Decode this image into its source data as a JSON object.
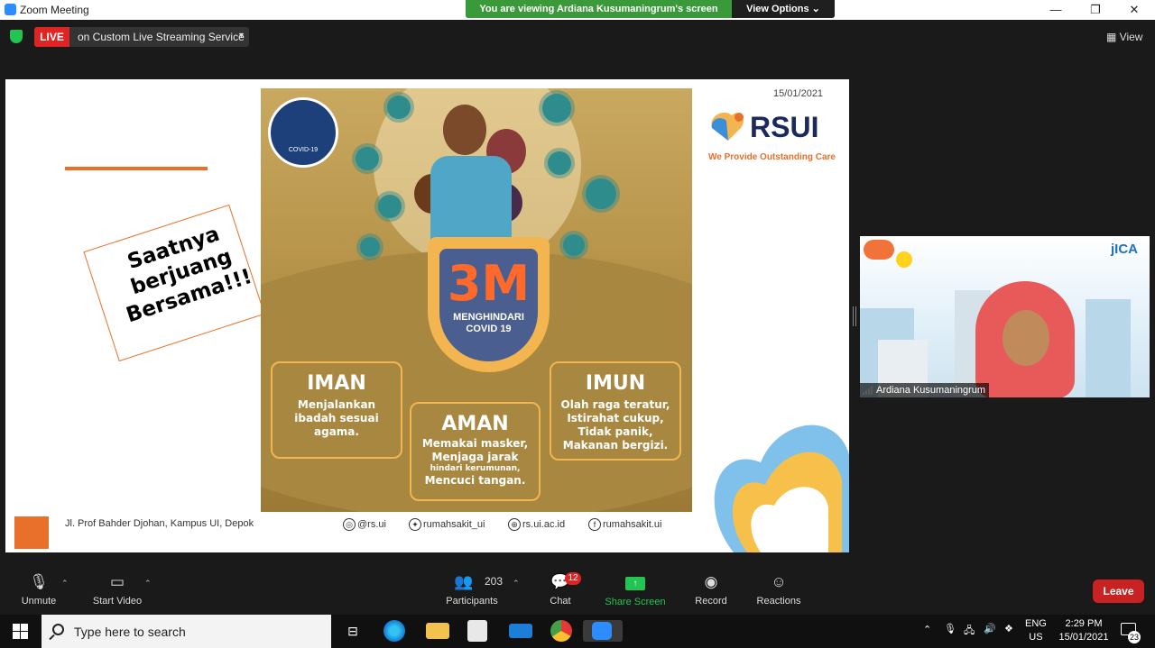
{
  "window": {
    "title": "Zoom Meeting",
    "viewing_banner": "You are viewing Ardiana Kusumaningrum's screen",
    "view_options": "View Options",
    "minimize": "—",
    "maximize": "❐",
    "close": "✕"
  },
  "meeting_bar": {
    "live_label": "LIVE",
    "live_service": "on Custom Live Streaming Service",
    "view_label": "View",
    "shield_color": "#23c552"
  },
  "slide": {
    "date": "15/01/2021",
    "brand": "RSUI",
    "tagline": "We Provide Outstanding Care",
    "sign_text": [
      "Saatnya",
      "berjuang",
      "Bersama!!!"
    ],
    "poster": {
      "logo_text": "COVID-19",
      "headline": "3M",
      "subheadline": [
        "MENGHINDARI",
        "COVID 19"
      ],
      "cards": [
        {
          "title": "IMAN",
          "lines": [
            "Menjalankan",
            "ibadah sesuai",
            "agama."
          ]
        },
        {
          "title": "AMAN",
          "lines": [
            "Memakai masker,",
            "Menjaga jarak",
            "hindari kerumunan,",
            "Mencuci tangan."
          ]
        },
        {
          "title": "IMUN",
          "lines": [
            "Olah raga teratur,",
            "Istirahat cukup,",
            "Tidak panik,",
            "Makanan bergizi."
          ]
        }
      ]
    },
    "footer": {
      "address": "Jl. Prof Bahder Djohan, Kampus UI, Depok",
      "socials": [
        {
          "icon": "instagram-icon",
          "glyph": "◎",
          "text": "@rs.ui"
        },
        {
          "icon": "twitter-icon",
          "glyph": "✦",
          "text": "rumahsakit_ui"
        },
        {
          "icon": "globe-icon",
          "glyph": "⊕",
          "text": "rs.ui.ac.id"
        },
        {
          "icon": "facebook-icon",
          "glyph": "f",
          "text": "rumahsakit.ui"
        }
      ]
    },
    "accent_color": "#e8702a"
  },
  "participant": {
    "name": "Ardiana Kusumaningrum",
    "background_label": "jICA"
  },
  "toolbar": {
    "unmute": "Unmute",
    "start_video": "Start Video",
    "participants": "Participants",
    "participants_count": "203",
    "chat": "Chat",
    "chat_badge": "12",
    "share_screen": "Share Screen",
    "record": "Record",
    "reactions": "Reactions",
    "leave": "Leave"
  },
  "taskbar": {
    "search_placeholder": "Type here to search",
    "lang_top": "ENG",
    "lang_bottom": "US",
    "time": "2:29 PM",
    "date": "15/01/2021",
    "notification_count": "23"
  }
}
